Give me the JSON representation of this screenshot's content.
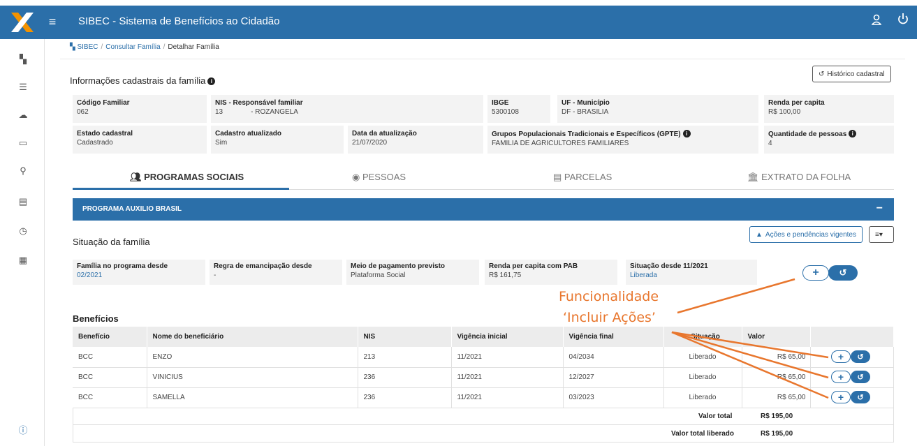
{
  "app": {
    "title": "SIBEC - Sistema de Benefícios ao Cidadão",
    "brand_color": "#2b6fa9",
    "accent_orange": "#e8762d"
  },
  "breadcrumb": [
    "SIBEC",
    "Consultar Família",
    "Detalhar Família"
  ],
  "family": {
    "section_title": "Informações cadastrais da família",
    "history_button": "Histórico cadastral",
    "fields": {
      "codigo": {
        "label": "Código Familiar",
        "value": "062"
      },
      "nis_resp": {
        "label": "NIS - Responsável familiar",
        "value": "13",
        "name": "- ROZANGELA"
      },
      "ibge": {
        "label": "IBGE",
        "value": "5300108"
      },
      "uf": {
        "label": "UF - Município",
        "value": "DF - BRASILIA"
      },
      "renda": {
        "label": "Renda per capita",
        "value": "R$ 100,00"
      },
      "estado": {
        "label": "Estado cadastral",
        "value": "Cadastrado"
      },
      "cad_atual": {
        "label": "Cadastro atualizado",
        "value": "Sim"
      },
      "data_atual": {
        "label": "Data da atualização",
        "value": "21/07/2020"
      },
      "gpte": {
        "label": "Grupos Populacionais Tradicionais e Específicos (GPTE)",
        "value": "FAMILIA DE AGRICULTORES FAMILIARES"
      },
      "qtd": {
        "label": "Quantidade de pessoas",
        "value": "4"
      }
    }
  },
  "tabs": [
    {
      "label": "PROGRAMAS SOCIAIS",
      "icon": "people-icon"
    },
    {
      "label": "PESSOAS",
      "icon": "person-icon"
    },
    {
      "label": "PARCELAS",
      "icon": "list-icon"
    },
    {
      "label": "EXTRATO DA FOLHA",
      "icon": "bank-icon"
    }
  ],
  "program": {
    "title": "PROGRAMA AUXILIO BRASIL",
    "collapse": "−"
  },
  "situacao": {
    "title": "Situação da família",
    "acoes_button": "Ações e pendências vigentes",
    "fields": {
      "desde": {
        "label": "Família no programa desde",
        "value": "02/2021"
      },
      "regra": {
        "label": "Regra de emancipação desde",
        "value": "-"
      },
      "meio": {
        "label": "Meio de pagamento previsto",
        "value": "Plataforma Social"
      },
      "renda_pab": {
        "label": "Renda per capita com PAB",
        "value": "R$ 161,75"
      },
      "sit_desde": {
        "label": "Situação desde 11/2021",
        "value": "Liberada"
      }
    }
  },
  "annotation": {
    "line1": "Funcionalidade",
    "line2": "‘Incluir Ações’"
  },
  "beneficios": {
    "title": "Benefícios",
    "headers": [
      "Benefício",
      "Nome do beneficiário",
      "NIS",
      "Vigência inicial",
      "Vigência final",
      "Situação",
      "Valor",
      ""
    ],
    "rows": [
      {
        "beneficio": "BCC",
        "nome": "ENZO",
        "nis": "213",
        "vig_ini": "11/2021",
        "vig_fim": "04/2034",
        "situacao": "Liberado",
        "valor": "R$ 65,00"
      },
      {
        "beneficio": "BCC",
        "nome": "VINICIUS",
        "nis": "236",
        "vig_ini": "11/2021",
        "vig_fim": "12/2027",
        "situacao": "Liberado",
        "valor": "R$ 65,00"
      },
      {
        "beneficio": "BCC",
        "nome": "SAMELLA",
        "nis": "236",
        "vig_ini": "11/2021",
        "vig_fim": "03/2023",
        "situacao": "Liberado",
        "valor": "R$ 65,00"
      }
    ],
    "valor_total_label": "Valor total",
    "valor_total": "R$ 195,00",
    "valor_liberado_label": "Valor total liberado",
    "valor_liberado": "R$ 195,00"
  }
}
